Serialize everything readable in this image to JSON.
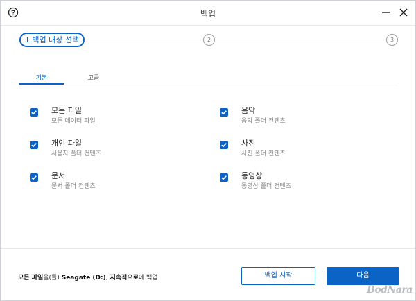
{
  "window": {
    "title": "백업"
  },
  "stepper": {
    "step1_label": "1.백업 대상 선택",
    "step2_label": "2",
    "step3_label": "3"
  },
  "tabs": [
    {
      "label": "기본",
      "active": true
    },
    {
      "label": "고급",
      "active": false
    }
  ],
  "options": {
    "all_files": {
      "title": "모든 파일",
      "sub": "모든 데이터 파일",
      "checked": true
    },
    "personal_files": {
      "title": "개인 파일",
      "sub": "사용자 폴더 컨텐츠",
      "checked": true
    },
    "documents": {
      "title": "문서",
      "sub": "문서 폴더 컨텐츠",
      "checked": true
    },
    "music": {
      "title": "음악",
      "sub": "음악 폴더 컨텐츠",
      "checked": true
    },
    "photos": {
      "title": "사진",
      "sub": "사진 폴더 컨텐츠",
      "checked": true
    },
    "videos": {
      "title": "동영상",
      "sub": "동영상 폴더 컨텐츠",
      "checked": true
    }
  },
  "footer": {
    "summary_target": "모든 파일",
    "summary_particle1": "을(를) ",
    "summary_drive": "Seagate (D:)",
    "summary_comma": ", ",
    "summary_mode": "지속적으로",
    "summary_tail": "에 백업",
    "start_button": "백업 시작",
    "next_button": "다음"
  },
  "watermark": "BodNara",
  "colors": {
    "accent": "#0b63c5",
    "muted_text": "#888888"
  }
}
